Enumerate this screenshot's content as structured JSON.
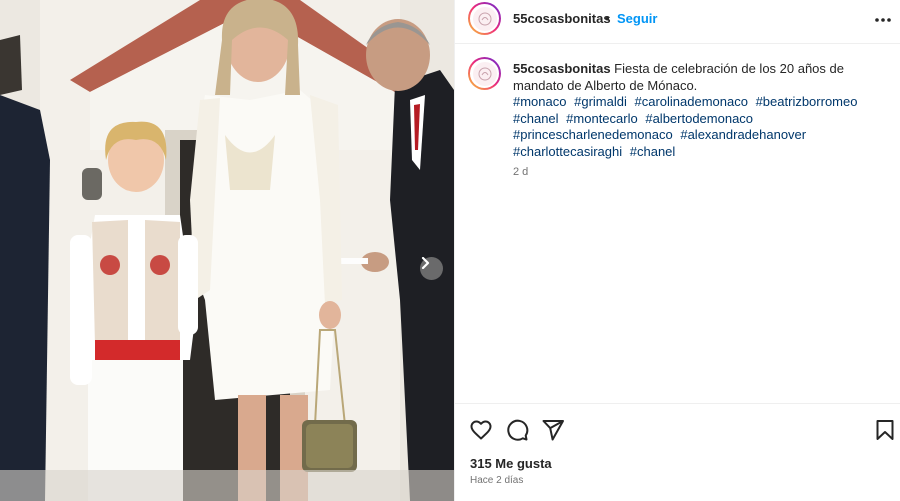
{
  "post": {
    "username": "55cosasbonitas",
    "separator": "•",
    "follow_label": "Seguir",
    "caption_username": "55cosasbonitas",
    "caption_text": "Fiesta de celebración de los 20 años de mandato de Alberto de Mónaco.",
    "hashtags": [
      "#monaco",
      "#grimaldi",
      "#carolinademonaco",
      "#beatrizborromeo",
      "#chanel",
      "#montecarlo",
      "#albertodemonaco",
      "#princescharlenedemonaco",
      "#alexandradehanover",
      "#charlottecasiraghi",
      "#chanel"
    ],
    "age_short": "2 d",
    "likes": "315 Me gusta",
    "posted_ago": "Hace 2 días"
  },
  "icons": {
    "more": "more-horizontal-icon",
    "next": "chevron-right-icon",
    "like": "heart-icon",
    "comment": "comment-icon",
    "share": "send-icon",
    "save": "bookmark-icon"
  },
  "colors": {
    "link": "#00376b",
    "follow": "#0095f6",
    "muted": "#737373",
    "text": "#262626"
  }
}
